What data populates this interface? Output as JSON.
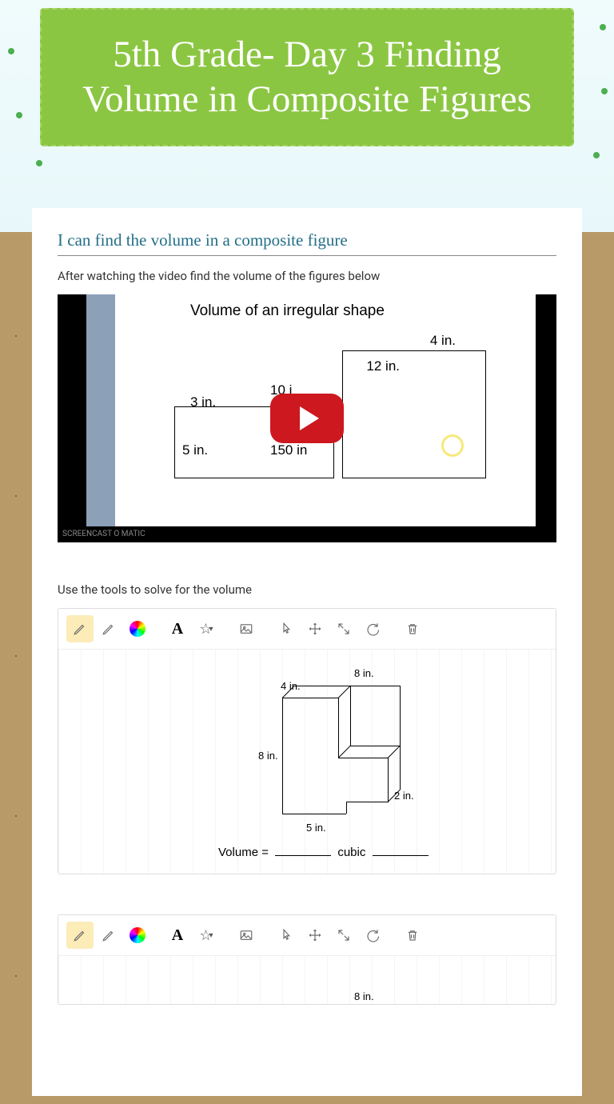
{
  "header": {
    "title": "5th Grade- Day 3 Finding Volume in Composite Figures"
  },
  "objective": "I can find the volume in a composite figure",
  "video_instruction": "After watching the video find the volume of the figures below",
  "video": {
    "title": "Volume of an irregular shape",
    "labels": {
      "a": "4 in.",
      "b": "12 in.",
      "c": "10 i",
      "d": "3 in.",
      "e": "5 in.",
      "f": "150 in"
    },
    "watermark": "SCREENCAST O MATIC"
  },
  "tool_instruction": "Use the tools to solve for the volume",
  "toolbar": {
    "text_tool": "A"
  },
  "figure1": {
    "top_right": "8 in.",
    "top_left": "4 in.",
    "left": "8 in.",
    "right": "2 in.",
    "bottom": "5 in.",
    "volume_prefix": "Volume =",
    "volume_mid": "cubic"
  },
  "figure2": {
    "top": "8 in."
  }
}
